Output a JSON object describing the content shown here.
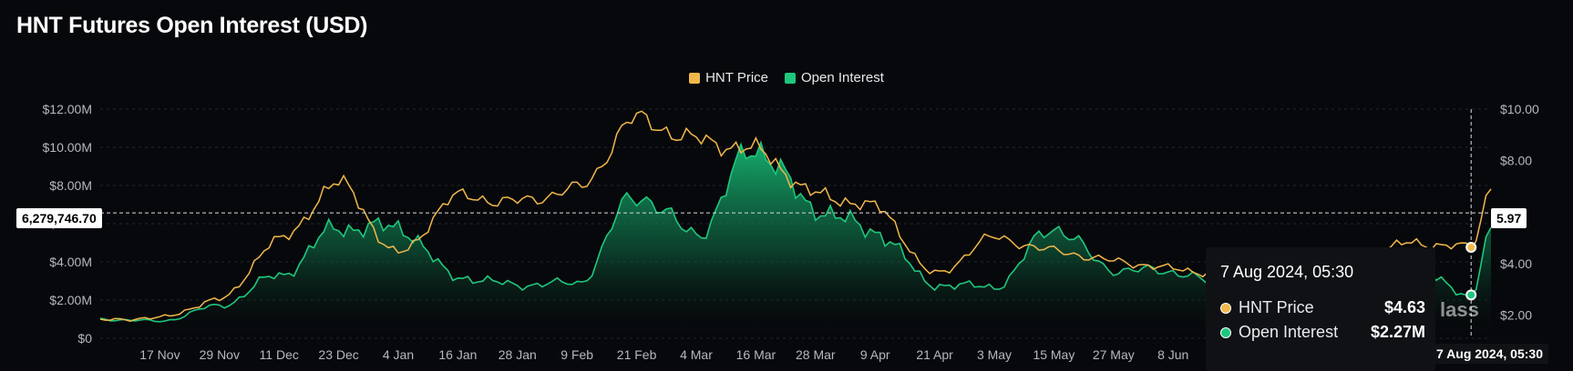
{
  "title": "HNT Futures Open Interest (USD)",
  "legend": [
    {
      "label": "HNT Price",
      "color": "#f2b84b"
    },
    {
      "label": "Open Interest",
      "color": "#1fc77e"
    }
  ],
  "crosshair": {
    "left_label": "6,279,746.70",
    "right_label": "5.97",
    "bottom_label": "7 Aug 2024, 05:30"
  },
  "tooltip": {
    "date": "7 Aug 2024, 05:30",
    "rows": [
      {
        "label": "HNT Price",
        "value": "$4.63",
        "color": "#f2b84b"
      },
      {
        "label": "Open Interest",
        "value": "$2.27M",
        "color": "#1fc77e"
      }
    ]
  },
  "watermark": "lass",
  "chart_data": {
    "type": "area",
    "title": "HNT Futures Open Interest (USD)",
    "y_left": {
      "label": "",
      "range": [
        0,
        12000000
      ],
      "ticks": [
        "$0",
        "$2.00M",
        "$4.00M",
        "$6.00M",
        "$8.00M",
        "$10.00M",
        "$12.00M"
      ]
    },
    "y_right": {
      "label": "",
      "range": [
        1.1,
        10
      ],
      "ticks": [
        "$2.00",
        "$4.00",
        "5.97",
        "$8.00",
        "$10.00"
      ]
    },
    "x_ticks": [
      "17 Nov",
      "29 Nov",
      "11 Dec",
      "23 Dec",
      "4 Jan",
      "16 Jan",
      "28 Jan",
      "9 Feb",
      "21 Feb",
      "4 Mar",
      "16 Mar",
      "28 Mar",
      "9 Apr",
      "21 Apr",
      "3 May",
      "15 May",
      "27 May",
      "8 Jun"
    ],
    "x_dates": [
      "2023-11-05",
      "2023-11-17",
      "2023-11-29",
      "2023-12-11",
      "2023-12-23",
      "2024-01-04",
      "2024-01-16",
      "2024-01-28",
      "2024-02-09",
      "2024-02-21",
      "2024-03-04",
      "2024-03-16",
      "2024-03-28",
      "2024-04-09",
      "2024-04-21",
      "2024-05-03",
      "2024-05-15",
      "2024-05-27",
      "2024-06-08",
      "2024-06-20",
      "2024-07-02",
      "2024-07-14",
      "2024-07-26",
      "2024-08-07",
      "2024-08-11"
    ],
    "grid": true,
    "legend_position": "top-center",
    "series": [
      {
        "name": "Open Interest",
        "axis": "left",
        "color": "#1fc77e",
        "values": [
          1000000,
          900000,
          1700000,
          3300000,
          5800000,
          5800000,
          3200000,
          2800000,
          2900000,
          7500000,
          5500000,
          10000000,
          6800000,
          5600000,
          2800000,
          2700000,
          5800000,
          3600000,
          3500000,
          2500000,
          2100000,
          1900000,
          3600000,
          2270000,
          5800000
        ]
      },
      {
        "name": "HNT Price",
        "axis": "right",
        "color": "#f2b84b",
        "values": [
          1.8,
          1.9,
          2.6,
          4.9,
          7.1,
          4.4,
          6.6,
          6.4,
          6.9,
          9.6,
          8.8,
          8.4,
          6.7,
          6.2,
          3.6,
          5.0,
          4.5,
          4.1,
          3.8,
          3.5,
          3.6,
          4.0,
          4.8,
          4.63,
          6.9
        ]
      }
    ]
  }
}
